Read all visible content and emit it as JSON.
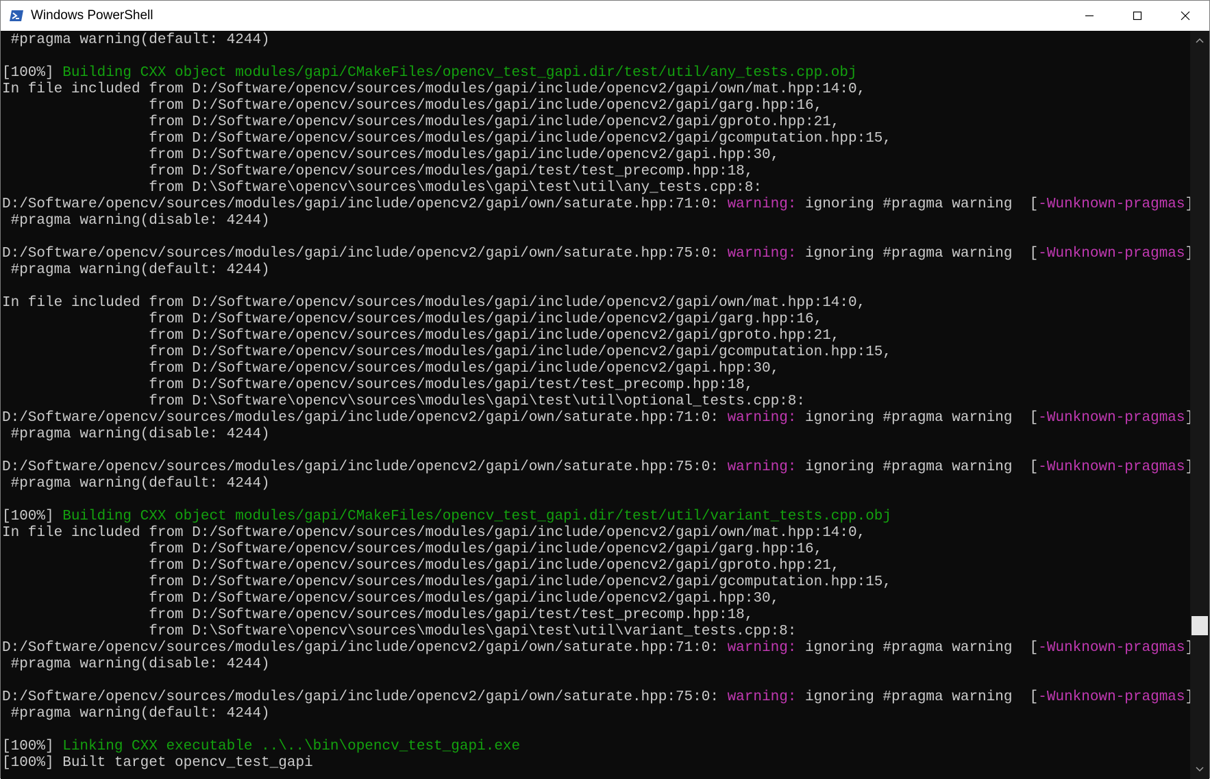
{
  "window": {
    "title": "Windows PowerShell"
  },
  "controls": {
    "minimize": "minimize-icon",
    "maximize": "maximize-icon",
    "close": "close-icon"
  },
  "colors": {
    "background": "#0c0c0c",
    "text": "#cccccc",
    "green": "#13a10e",
    "magenta": "#c239b3"
  },
  "scrollbar": {
    "position_fraction": 0.82
  },
  "lines": [
    [
      {
        "t": " #pragma warning(default: 4244)"
      }
    ],
    [
      {
        "t": ""
      }
    ],
    [
      {
        "t": "[100%] "
      },
      {
        "t": "Building CXX object modules/gapi/CMakeFiles/opencv_test_gapi.dir/test/util/any_tests.cpp.obj",
        "c": "green"
      }
    ],
    [
      {
        "t": "In file included from D:/Software/opencv/sources/modules/gapi/include/opencv2/gapi/own/mat.hpp:14:0,"
      }
    ],
    [
      {
        "t": "                 from D:/Software/opencv/sources/modules/gapi/include/opencv2/gapi/garg.hpp:16,"
      }
    ],
    [
      {
        "t": "                 from D:/Software/opencv/sources/modules/gapi/include/opencv2/gapi/gproto.hpp:21,"
      }
    ],
    [
      {
        "t": "                 from D:/Software/opencv/sources/modules/gapi/include/opencv2/gapi/gcomputation.hpp:15,"
      }
    ],
    [
      {
        "t": "                 from D:/Software/opencv/sources/modules/gapi/include/opencv2/gapi.hpp:30,"
      }
    ],
    [
      {
        "t": "                 from D:/Software/opencv/sources/modules/gapi/test/test_precomp.hpp:18,"
      }
    ],
    [
      {
        "t": "                 from D:\\Software\\opencv\\sources\\modules\\gapi\\test\\util\\any_tests.cpp:8:"
      }
    ],
    [
      {
        "t": "D:/Software/opencv/sources/modules/gapi/include/opencv2/gapi/own/saturate.hpp:71:0: "
      },
      {
        "t": "warning:",
        "c": "magenta"
      },
      {
        "t": " ignoring #pragma warning  ["
      },
      {
        "t": "-Wunknown-pragmas",
        "c": "magenta"
      },
      {
        "t": "]"
      }
    ],
    [
      {
        "t": " #pragma warning(disable: 4244)"
      }
    ],
    [
      {
        "t": ""
      }
    ],
    [
      {
        "t": "D:/Software/opencv/sources/modules/gapi/include/opencv2/gapi/own/saturate.hpp:75:0: "
      },
      {
        "t": "warning:",
        "c": "magenta"
      },
      {
        "t": " ignoring #pragma warning  ["
      },
      {
        "t": "-Wunknown-pragmas",
        "c": "magenta"
      },
      {
        "t": "]"
      }
    ],
    [
      {
        "t": " #pragma warning(default: 4244)"
      }
    ],
    [
      {
        "t": ""
      }
    ],
    [
      {
        "t": "In file included from D:/Software/opencv/sources/modules/gapi/include/opencv2/gapi/own/mat.hpp:14:0,"
      }
    ],
    [
      {
        "t": "                 from D:/Software/opencv/sources/modules/gapi/include/opencv2/gapi/garg.hpp:16,"
      }
    ],
    [
      {
        "t": "                 from D:/Software/opencv/sources/modules/gapi/include/opencv2/gapi/gproto.hpp:21,"
      }
    ],
    [
      {
        "t": "                 from D:/Software/opencv/sources/modules/gapi/include/opencv2/gapi/gcomputation.hpp:15,"
      }
    ],
    [
      {
        "t": "                 from D:/Software/opencv/sources/modules/gapi/include/opencv2/gapi.hpp:30,"
      }
    ],
    [
      {
        "t": "                 from D:/Software/opencv/sources/modules/gapi/test/test_precomp.hpp:18,"
      }
    ],
    [
      {
        "t": "                 from D:\\Software\\opencv\\sources\\modules\\gapi\\test\\util\\optional_tests.cpp:8:"
      }
    ],
    [
      {
        "t": "D:/Software/opencv/sources/modules/gapi/include/opencv2/gapi/own/saturate.hpp:71:0: "
      },
      {
        "t": "warning:",
        "c": "magenta"
      },
      {
        "t": " ignoring #pragma warning  ["
      },
      {
        "t": "-Wunknown-pragmas",
        "c": "magenta"
      },
      {
        "t": "]"
      }
    ],
    [
      {
        "t": " #pragma warning(disable: 4244)"
      }
    ],
    [
      {
        "t": ""
      }
    ],
    [
      {
        "t": "D:/Software/opencv/sources/modules/gapi/include/opencv2/gapi/own/saturate.hpp:75:0: "
      },
      {
        "t": "warning:",
        "c": "magenta"
      },
      {
        "t": " ignoring #pragma warning  ["
      },
      {
        "t": "-Wunknown-pragmas",
        "c": "magenta"
      },
      {
        "t": "]"
      }
    ],
    [
      {
        "t": " #pragma warning(default: 4244)"
      }
    ],
    [
      {
        "t": ""
      }
    ],
    [
      {
        "t": "[100%] "
      },
      {
        "t": "Building CXX object modules/gapi/CMakeFiles/opencv_test_gapi.dir/test/util/variant_tests.cpp.obj",
        "c": "green"
      }
    ],
    [
      {
        "t": "In file included from D:/Software/opencv/sources/modules/gapi/include/opencv2/gapi/own/mat.hpp:14:0,"
      }
    ],
    [
      {
        "t": "                 from D:/Software/opencv/sources/modules/gapi/include/opencv2/gapi/garg.hpp:16,"
      }
    ],
    [
      {
        "t": "                 from D:/Software/opencv/sources/modules/gapi/include/opencv2/gapi/gproto.hpp:21,"
      }
    ],
    [
      {
        "t": "                 from D:/Software/opencv/sources/modules/gapi/include/opencv2/gapi/gcomputation.hpp:15,"
      }
    ],
    [
      {
        "t": "                 from D:/Software/opencv/sources/modules/gapi/include/opencv2/gapi.hpp:30,"
      }
    ],
    [
      {
        "t": "                 from D:/Software/opencv/sources/modules/gapi/test/test_precomp.hpp:18,"
      }
    ],
    [
      {
        "t": "                 from D:\\Software\\opencv\\sources\\modules\\gapi\\test\\util\\variant_tests.cpp:8:"
      }
    ],
    [
      {
        "t": "D:/Software/opencv/sources/modules/gapi/include/opencv2/gapi/own/saturate.hpp:71:0: "
      },
      {
        "t": "warning:",
        "c": "magenta"
      },
      {
        "t": " ignoring #pragma warning  ["
      },
      {
        "t": "-Wunknown-pragmas",
        "c": "magenta"
      },
      {
        "t": "]"
      }
    ],
    [
      {
        "t": " #pragma warning(disable: 4244)"
      }
    ],
    [
      {
        "t": ""
      }
    ],
    [
      {
        "t": "D:/Software/opencv/sources/modules/gapi/include/opencv2/gapi/own/saturate.hpp:75:0: "
      },
      {
        "t": "warning:",
        "c": "magenta"
      },
      {
        "t": " ignoring #pragma warning  ["
      },
      {
        "t": "-Wunknown-pragmas",
        "c": "magenta"
      },
      {
        "t": "]"
      }
    ],
    [
      {
        "t": " #pragma warning(default: 4244)"
      }
    ],
    [
      {
        "t": ""
      }
    ],
    [
      {
        "t": "[100%] "
      },
      {
        "t": "Linking CXX executable ..\\..\\bin\\opencv_test_gapi.exe",
        "c": "green"
      }
    ],
    [
      {
        "t": "[100%] Built target opencv_test_gapi"
      }
    ]
  ]
}
